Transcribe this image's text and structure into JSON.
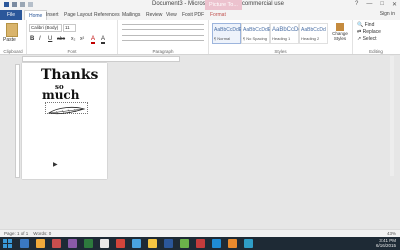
{
  "window": {
    "title": "Document3 - Microsoft Word non-commercial use",
    "context_tab": "Picture To...",
    "controls": [
      "?",
      "—",
      "□",
      "✕"
    ]
  },
  "ribbon_tabs": [
    "File",
    "Home",
    "Insert",
    "Page Layout",
    "References",
    "Mailings",
    "Review",
    "View",
    "Foxit PDF",
    "Format"
  ],
  "signin_label": "Sign in",
  "ribbon": {
    "clipboard": {
      "paste_label": "Paste",
      "group_label": "Clipboard"
    },
    "font": {
      "font_name": "Calibri (Body)",
      "font_size": "11",
      "format_buttons": [
        "B",
        "I",
        "U",
        "abc",
        "x₂",
        "x²",
        "A",
        "A"
      ],
      "group_label": "Font"
    },
    "paragraph": {
      "group_label": "Paragraph"
    },
    "styles": {
      "items": [
        {
          "preview": "AaBbCcDdEe",
          "name": "¶ Normal"
        },
        {
          "preview": "AaBbCcDdEe",
          "name": "¶ No Spacing"
        },
        {
          "preview": "AaBbCcDd",
          "name": "Heading 1"
        },
        {
          "preview": "AaBbCcDd",
          "name": "Heading 2"
        }
      ],
      "change_styles_label": "Change Styles",
      "group_label": "Styles"
    },
    "editing": {
      "find_label": "Find",
      "replace_label": "Replace",
      "select_label": "Select",
      "group_label": "Editing"
    }
  },
  "document": {
    "line1": "Thanks",
    "line2": "so",
    "line3": "much"
  },
  "status": {
    "page": "Page: 1 of 1",
    "words": "Words: 0",
    "zoom": "43%"
  },
  "taskbar": {
    "time": "3:41 PM",
    "date": "6/16/2015",
    "icon_colors": [
      "#3a78c3",
      "#f0a93b",
      "#c94e4e",
      "#8a5aa8",
      "#2d7a3d",
      "#e9e9e9",
      "#d2453b",
      "#4aa3df",
      "#f5c542",
      "#2b579a",
      "#6bb34a",
      "#c43c3c",
      "#1f8cd6",
      "#e98a2d",
      "#2f9ec7"
    ]
  }
}
